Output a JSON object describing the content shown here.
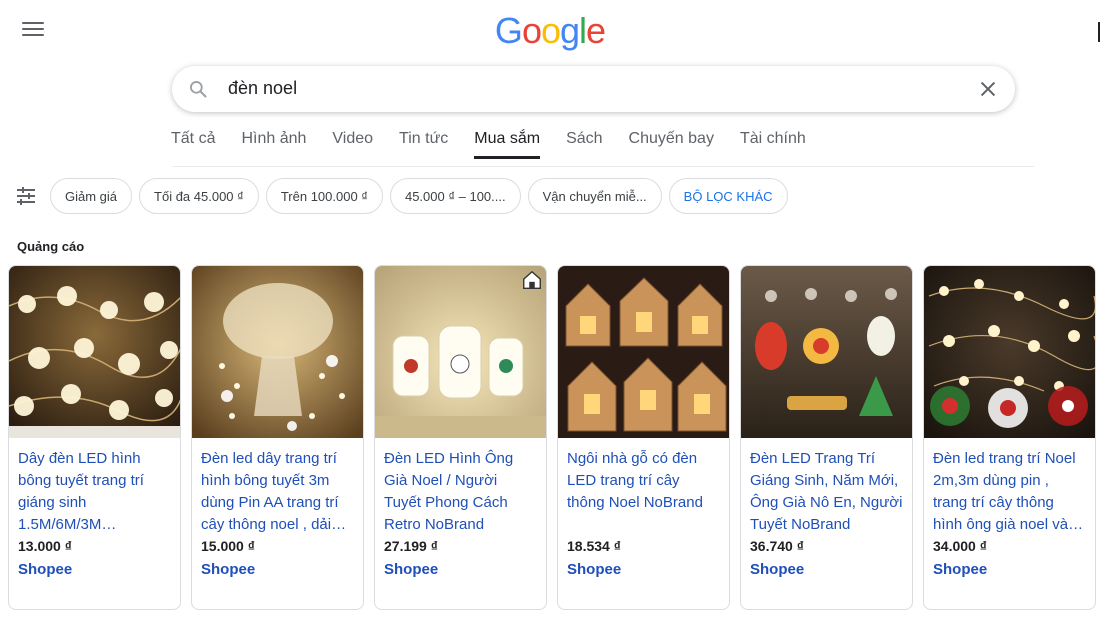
{
  "header": {
    "logo_letters": [
      {
        "ch": "G",
        "color": "#4285F4"
      },
      {
        "ch": "o",
        "color": "#EA4335"
      },
      {
        "ch": "o",
        "color": "#FBBC05"
      },
      {
        "ch": "g",
        "color": "#4285F4"
      },
      {
        "ch": "l",
        "color": "#34A853"
      },
      {
        "ch": "e",
        "color": "#EA4335"
      }
    ]
  },
  "search": {
    "query": "đèn noel"
  },
  "tabs": [
    {
      "label": "Tất cả",
      "active": false
    },
    {
      "label": "Hình ảnh",
      "active": false
    },
    {
      "label": "Video",
      "active": false
    },
    {
      "label": "Tin tức",
      "active": false
    },
    {
      "label": "Mua sắm",
      "active": true
    },
    {
      "label": "Sách",
      "active": false
    },
    {
      "label": "Chuyến bay",
      "active": false
    },
    {
      "label": "Tài chính",
      "active": false
    }
  ],
  "filters": [
    {
      "label": "Giảm giá"
    },
    {
      "label": "Tối đa 45.000 ₫"
    },
    {
      "label": "Trên 100.000 ₫"
    },
    {
      "label": "45.000 ₫ – 100...."
    },
    {
      "label": "Vận chuyển miễ..."
    },
    {
      "label": "BỘ LỌC KHÁC"
    }
  ],
  "section": {
    "ad_label": "Quảng cáo"
  },
  "products": [
    {
      "title": "Dây đèn LED hình bông tuyết trang trí giáng sinh 1.5M/6M/3M…",
      "price": "13.000 ₫",
      "store": "Shopee"
    },
    {
      "title": "Đèn led dây trang trí hình bông tuyết 3m dùng Pin AA trang trí cây thông noel , dải…",
      "price": "15.000 ₫",
      "store": "Shopee"
    },
    {
      "title": "Đèn LED Hình Ông Già Noel / Người Tuyết Phong Cách Retro NoBrand",
      "price": "27.199 ₫",
      "store": "Shopee"
    },
    {
      "title": "Ngôi nhà gỗ có đèn LED trang trí cây thông Noel NoBrand",
      "price": "18.534 ₫",
      "store": "Shopee"
    },
    {
      "title": "Đèn LED Trang Trí Giáng Sinh, Năm Mới, Ông Già Nô En, Người Tuyết NoBrand",
      "price": "36.740 ₫",
      "store": "Shopee"
    },
    {
      "title": "Đèn led trang trí Noel 2m,3m dùng pin , trang trí cây thông hình ông già noel và…",
      "price": "34.000 ₫",
      "store": "Shopee"
    }
  ]
}
